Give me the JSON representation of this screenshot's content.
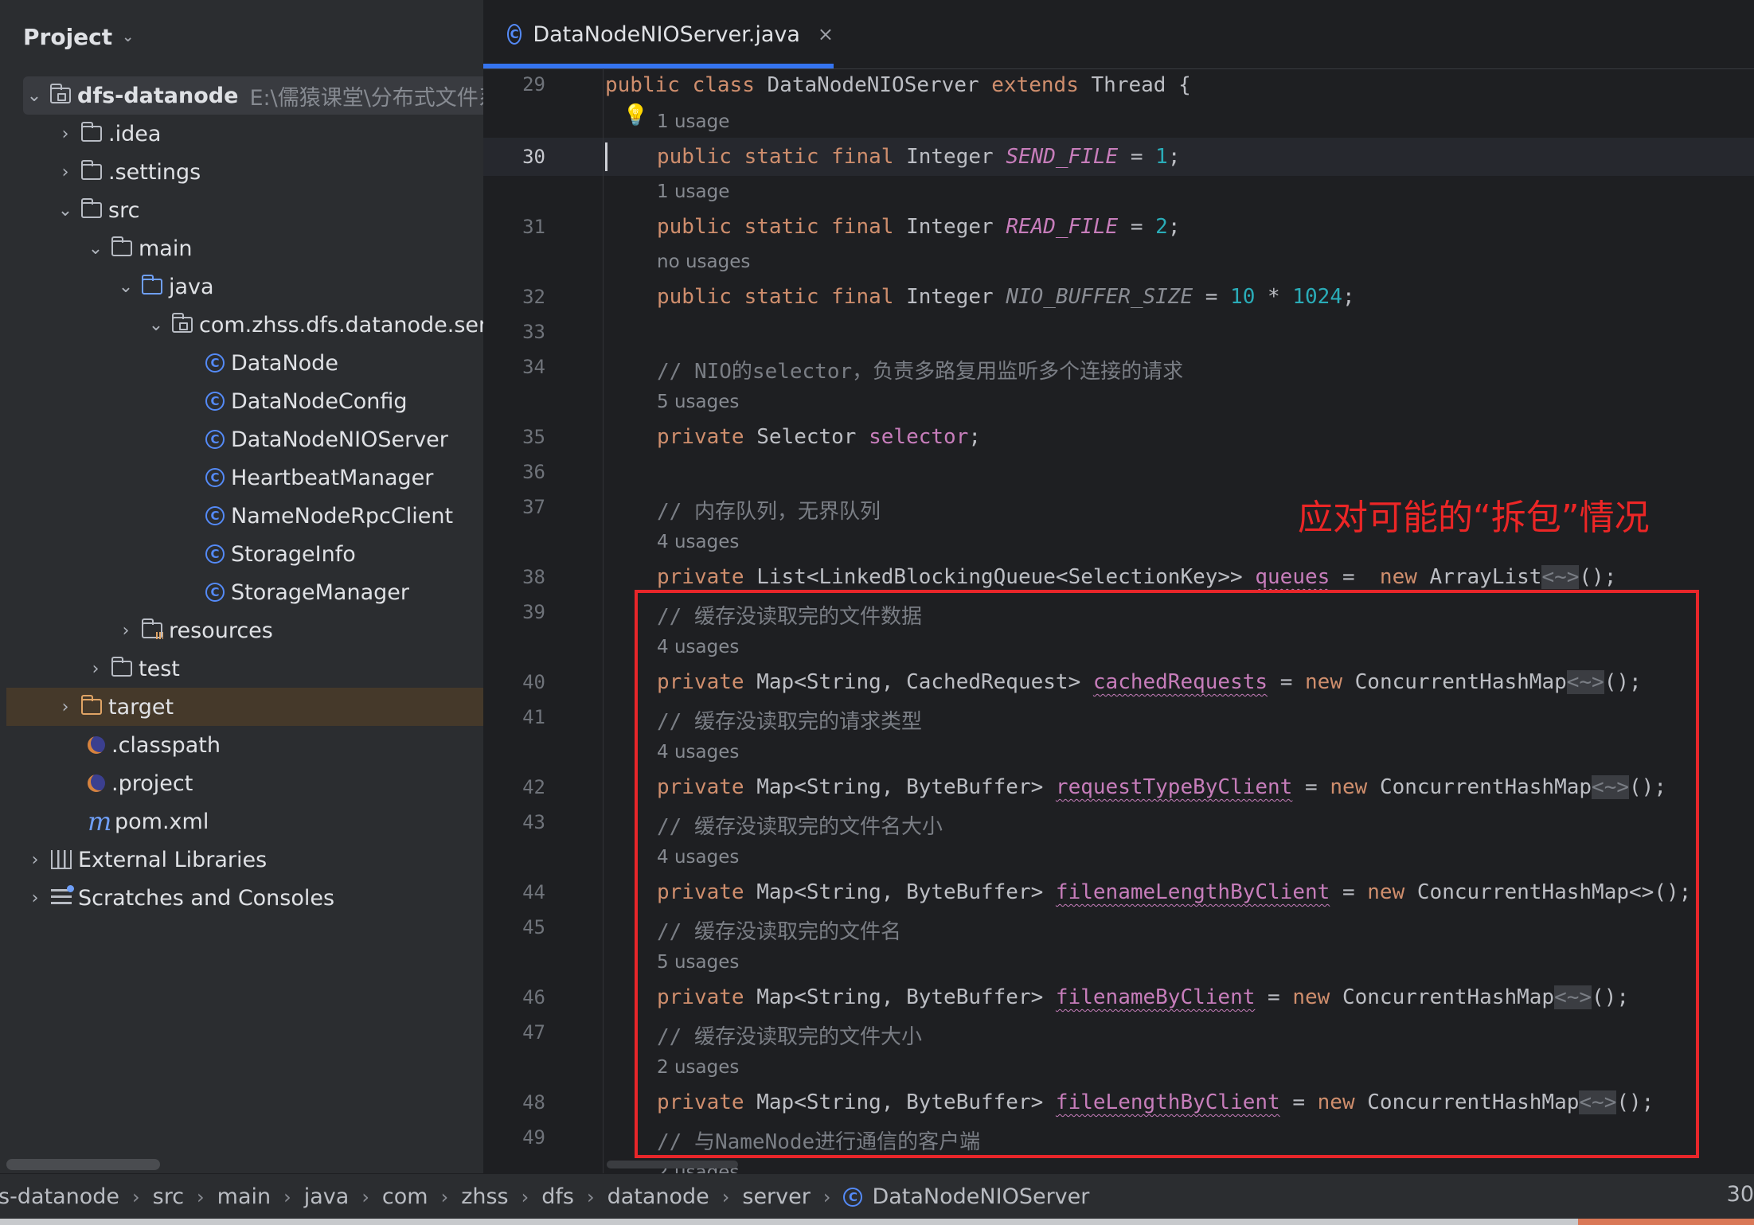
{
  "project_panel": {
    "title": "Project",
    "tree": [
      {
        "label": "dfs-datanode",
        "path": "E:\\儒猿课堂\\分布式文件系统"
      },
      {
        "label": ".idea"
      },
      {
        "label": ".settings"
      },
      {
        "label": "src"
      },
      {
        "label": "main"
      },
      {
        "label": "java"
      },
      {
        "label": "com.zhss.dfs.datanode.server"
      },
      {
        "label": "DataNode"
      },
      {
        "label": "DataNodeConfig"
      },
      {
        "label": "DataNodeNIOServer"
      },
      {
        "label": "HeartbeatManager"
      },
      {
        "label": "NameNodeRpcClient"
      },
      {
        "label": "StorageInfo"
      },
      {
        "label": "StorageManager"
      },
      {
        "label": "resources"
      },
      {
        "label": "test"
      },
      {
        "label": "target"
      },
      {
        "label": ".classpath"
      },
      {
        "label": ".project"
      },
      {
        "label": "pom.xml"
      },
      {
        "label": "External Libraries"
      },
      {
        "label": "Scratches and Consoles"
      }
    ]
  },
  "editor": {
    "tab": {
      "label": "DataNodeNIOServer.java",
      "close": "×"
    },
    "line_numbers": [
      "29",
      "30",
      "31",
      "32",
      "33",
      "34",
      "35",
      "36",
      "37",
      "38",
      "39",
      "40",
      "41",
      "42",
      "43",
      "44",
      "45",
      "46",
      "47",
      "48",
      "49"
    ],
    "hints": [
      "1 usage",
      "1 usage",
      "no usages",
      "5 usages",
      "4 usages",
      "4 usages",
      "4 usages",
      "4 usages",
      "5 usages",
      "2 usages",
      "2 usages"
    ],
    "code": {
      "l29": {
        "k1": "public",
        "k2": "class",
        "name": "DataNodeNIOServer",
        "k3": "extends",
        "base": "Thread {"
      },
      "l30": {
        "mods": "public static final",
        "type": "Integer",
        "name": "SEND_FILE",
        "eq": " = ",
        "val": "1",
        "end": ";"
      },
      "l31": {
        "mods": "public static final",
        "type": "Integer",
        "name": "READ_FILE",
        "eq": " = ",
        "val": "2",
        "end": ";"
      },
      "l32": {
        "mods": "public static final",
        "type": "Integer",
        "name": "NIO_BUFFER_SIZE",
        "eq": " = ",
        "v1": "10",
        "op": " * ",
        "v2": "1024",
        "end": ";"
      },
      "l34": "// NIO的selector，负责多路复用监听多个连接的请求",
      "l35": {
        "mod": "private",
        "type": "Selector",
        "name": "selector",
        "end": ";"
      },
      "l37": "// 内存队列，无界队列",
      "l38": {
        "mod": "private",
        "type": "List<LinkedBlockingQueue<SelectionKey>>",
        "name": "queues",
        "eq": " =  ",
        "kw": "new",
        "cls": "ArrayList",
        "dmd": "<~>",
        "end": "();"
      },
      "l39": "// 缓存没读取完的文件数据",
      "l40": {
        "mod": "private",
        "type": "Map<String, CachedRequest>",
        "name": "cachedRequests",
        "eq": " = ",
        "kw": "new",
        "cls": "ConcurrentHashMap",
        "dmd": "<~>",
        "end": "();"
      },
      "l41": "// 缓存没读取完的请求类型",
      "l42": {
        "mod": "private",
        "type": "Map<String, ByteBuffer>",
        "name": "requestTypeByClient",
        "eq": " = ",
        "kw": "new",
        "cls": "ConcurrentHashMap",
        "dmd": "<~>",
        "end": "();"
      },
      "l43": "// 缓存没读取完的文件名大小",
      "l44": {
        "mod": "private",
        "type": "Map<String, ByteBuffer>",
        "name": "filenameLengthByClient",
        "eq": " = ",
        "kw": "new",
        "cls": "ConcurrentHashMap<>",
        "end": "();"
      },
      "l45": "// 缓存没读取完的文件名",
      "l46": {
        "mod": "private",
        "type": "Map<String, ByteBuffer>",
        "name": "filenameByClient",
        "eq": " = ",
        "kw": "new",
        "cls": "ConcurrentHashMap",
        "dmd": "<~>",
        "end": "();"
      },
      "l47": "// 缓存没读取完的文件大小",
      "l48": {
        "mod": "private",
        "type": "Map<String, ByteBuffer>",
        "name": "fileLengthByClient",
        "eq": " = ",
        "kw": "new",
        "cls": "ConcurrentHashMap",
        "dmd": "<~>",
        "end": "();"
      },
      "l49": "// 与NameNode进行通信的客户端"
    },
    "annotation": "应对可能的“拆包”情况"
  },
  "statusbar": {
    "breadcrumbs": [
      "s-datanode",
      "src",
      "main",
      "java",
      "com",
      "zhss",
      "dfs",
      "datanode",
      "server",
      "DataNodeNIOServer"
    ],
    "separator": "›",
    "position": "30"
  },
  "colors": {
    "keyword": "#cf8e6d",
    "constant": "#c77dbb",
    "number": "#2aacb8",
    "comment": "#7a7e85",
    "accent": "#3574f0",
    "annotation": "#ec2626"
  },
  "icons": {
    "class": "C",
    "chevron_down": "⌄",
    "arrow_right": "›",
    "arrow_down": "⌄",
    "bulb": "💡",
    "maven": "m"
  }
}
